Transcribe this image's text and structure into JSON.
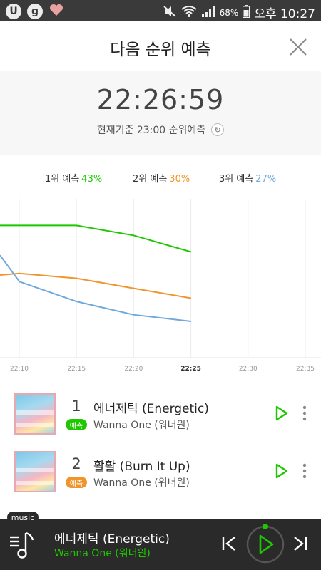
{
  "status_bar": {
    "battery": "68%",
    "time": "오후 10:27"
  },
  "header": {
    "title": "다음 순위 예측"
  },
  "timer": {
    "clock": "22:26:59",
    "basis": "현재기준 23:00 순위예측"
  },
  "legend": [
    {
      "label": "1위 예측",
      "value": "43%",
      "color": "#1ec800"
    },
    {
      "label": "2위 예측",
      "value": "30%",
      "color": "#f0952b"
    },
    {
      "label": "3위 예측",
      "value": "27%",
      "color": "#6fa8dc"
    }
  ],
  "chart_data": {
    "type": "line",
    "x": [
      "22:10",
      "22:15",
      "22:20",
      "22:25",
      "22:30",
      "22:35"
    ],
    "highlight_tick": "22:25",
    "grid": "vertical",
    "series": [
      {
        "name": "1위 예측",
        "color": "#1ec800",
        "points": [
          [
            22.055,
            80
          ],
          [
            22.25,
            80
          ],
          [
            22.333,
            74
          ],
          [
            22.417,
            64
          ]
        ]
      },
      {
        "name": "2위 예측",
        "color": "#f0952b",
        "points": [
          [
            22.055,
            50
          ],
          [
            22.167,
            51
          ],
          [
            22.25,
            48
          ],
          [
            22.333,
            42
          ],
          [
            22.417,
            36
          ]
        ]
      },
      {
        "name": "3위 예측",
        "color": "#6fa8dc",
        "points": [
          [
            22.055,
            62
          ],
          [
            22.167,
            46
          ],
          [
            22.25,
            34
          ],
          [
            22.333,
            26
          ],
          [
            22.417,
            22
          ]
        ]
      }
    ]
  },
  "songs": [
    {
      "rank": "1",
      "badge": "예측",
      "badge_color": "#1ec800",
      "title": "에너제틱 (Energetic)",
      "artist": "Wanna One (워너원)"
    },
    {
      "rank": "2",
      "badge": "예측",
      "badge_color": "#f0952b",
      "title": "활활 (Burn It Up)",
      "artist": "Wanna One (워너원)"
    }
  ],
  "player": {
    "tag": "music",
    "title": "에너제틱 (Energetic)",
    "artist": "Wanna One (워너원)",
    "accent": "#1ec800"
  }
}
